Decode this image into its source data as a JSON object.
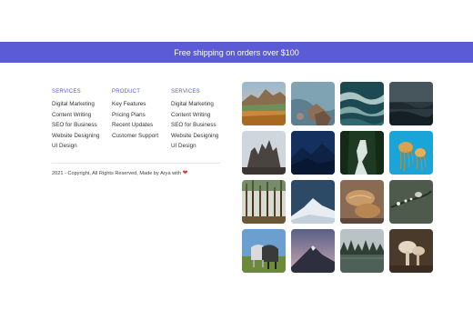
{
  "banner": {
    "text": "Free shipping on orders over $100"
  },
  "footer": {
    "columns": [
      {
        "title": "SERVICES",
        "links": [
          "Digital Marketing",
          "Content Writing",
          "SEO for Business",
          "Website Designing",
          "UI Design"
        ]
      },
      {
        "title": "PRODUCT",
        "links": [
          "Key Features",
          "Pricing Plans",
          "Recent Updates",
          "Customer Support"
        ]
      },
      {
        "title": "SERVICES",
        "links": [
          "Digital Marketing",
          "Content Writing",
          "SEO for Business",
          "Website Designing",
          "UI Design"
        ]
      }
    ],
    "copyright": "2021 - Copyright, All Rights Reserved, Made by Arya with",
    "heart": "❤"
  },
  "colors": {
    "accent": "#5b5bd6",
    "heart": "#e53935"
  },
  "gallery": [
    {
      "name": "mountain-lake-photo"
    },
    {
      "name": "rocky-coast-photo"
    },
    {
      "name": "waves-photo"
    },
    {
      "name": "stormy-sea-photo"
    },
    {
      "name": "rock-peaks-photo"
    },
    {
      "name": "night-mountains-photo"
    },
    {
      "name": "forest-river-photo"
    },
    {
      "name": "jellyfish-photo"
    },
    {
      "name": "pine-forest-photo"
    },
    {
      "name": "snow-peak-photo"
    },
    {
      "name": "bread-photo"
    },
    {
      "name": "bird-on-branch-photo"
    },
    {
      "name": "horses-photo"
    },
    {
      "name": "dusk-mountain-photo"
    },
    {
      "name": "lake-trees-photo"
    },
    {
      "name": "mushrooms-photo"
    }
  ]
}
